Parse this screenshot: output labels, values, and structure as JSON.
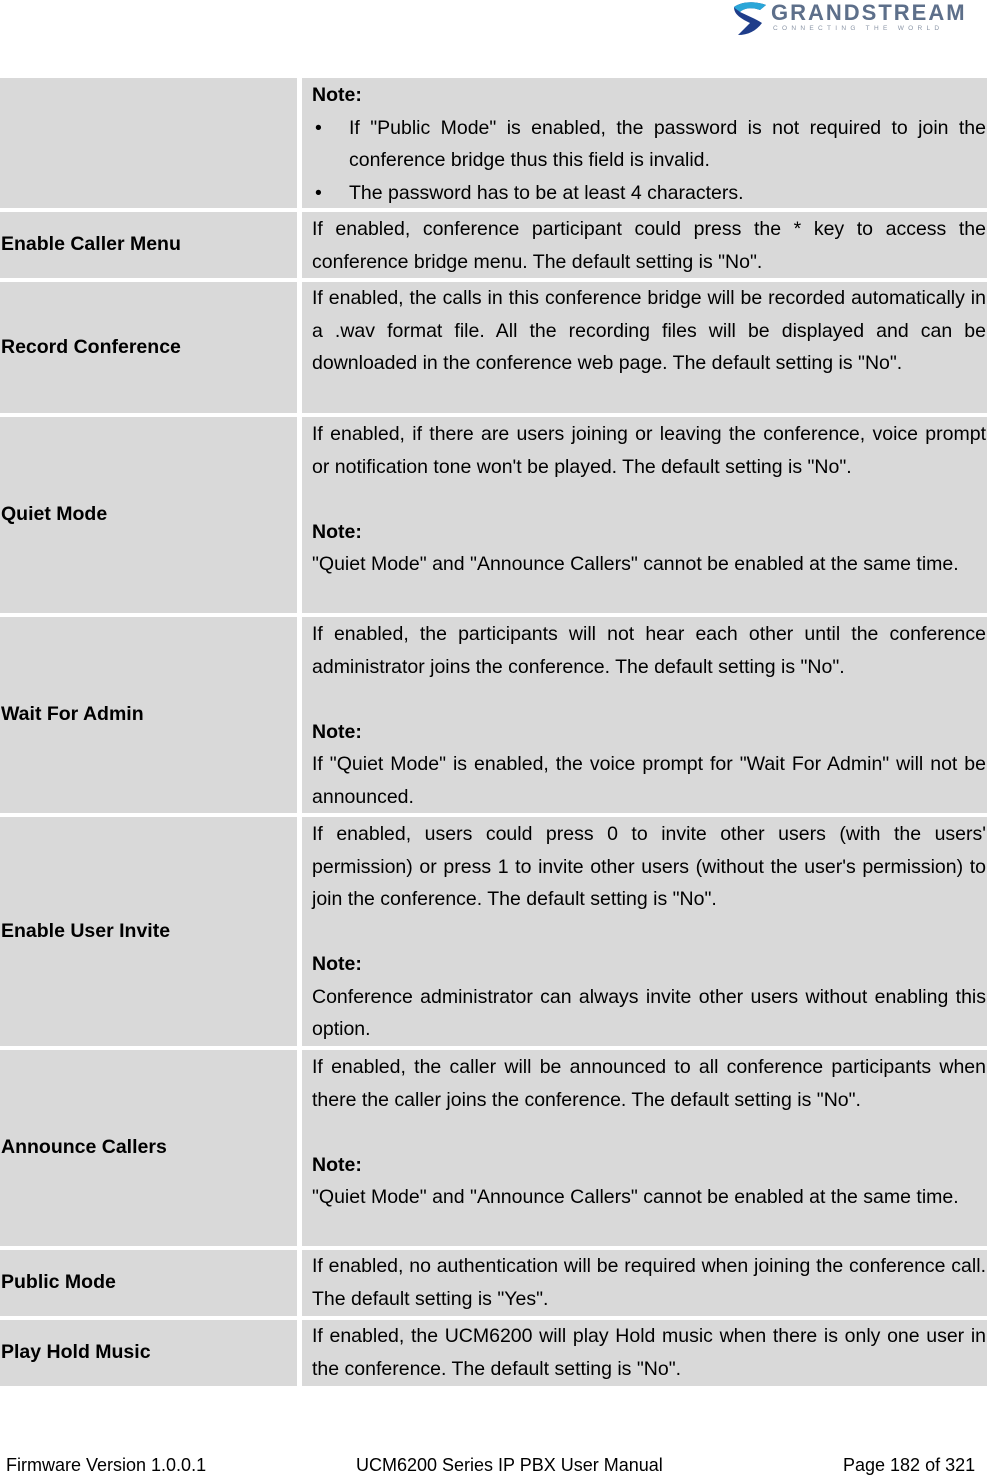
{
  "header": {
    "logo_word": "GRANDSTREAM",
    "logo_tagline": "CONNECTING THE WORLD",
    "logo_colors": {
      "dark": "#1f3d8a",
      "light": "#2aa6d8",
      "text": "#5d6f8a"
    }
  },
  "table": {
    "rows": [
      {
        "label": "",
        "note_heading": "Note:",
        "bullets": [
          "If \"Public Mode\" is enabled, the password is not required to join the conference bridge thus this field is invalid.",
          "The password has to be at least 4 characters."
        ]
      },
      {
        "label": "Enable Caller Menu",
        "text": "If enabled, conference participant could press the * key to access the conference bridge menu. The default setting is \"No\"."
      },
      {
        "label": "Record Conference",
        "text": "If enabled, the calls in this conference bridge will be recorded automatically in a .wav format file. All the recording files will be displayed and can be downloaded in the conference web page. The default setting is \"No\"."
      },
      {
        "label": "Quiet Mode",
        "text": "If enabled, if there are users joining or leaving the conference, voice prompt or notification tone won't be played. The default setting is \"No\".",
        "note_heading": "Note:",
        "note": "\"Quiet Mode\" and \"Announce Callers\" cannot be enabled at the same time."
      },
      {
        "label": "Wait For Admin",
        "text": "If enabled, the participants will not hear each other until the conference administrator joins the conference. The default setting is \"No\".",
        "note_heading": "Note:",
        "note": "If \"Quiet Mode\" is enabled, the voice prompt for \"Wait For Admin\" will not be announced."
      },
      {
        "label": "Enable User Invite",
        "text": "If enabled, users could press 0 to invite other users (with the users' permission) or press 1 to invite other users (without the user's permission) to join the conference. The default setting is \"No\".",
        "note_heading": "Note:",
        "note": "Conference administrator can always invite other users without enabling this option."
      },
      {
        "label": "Announce Callers",
        "text": "If enabled, the caller will be announced to all conference participants when there the caller joins the conference. The default setting is \"No\".",
        "note_heading": "Note:",
        "note": "\"Quiet Mode\" and \"Announce Callers\" cannot be enabled at the same time."
      },
      {
        "label": "Public Mode",
        "text": "If enabled, no authentication will be required when joining the conference call. The default setting is \"Yes\"."
      },
      {
        "label": "Play Hold Music",
        "text": "If enabled, the UCM6200 will play Hold music when there is only one user in the conference. The default setting is \"No\"."
      }
    ]
  },
  "footer": {
    "firmware": "Firmware Version 1.0.0.1",
    "manual": "UCM6200 Series IP PBX User Manual",
    "page": "Page 182 of 321"
  }
}
